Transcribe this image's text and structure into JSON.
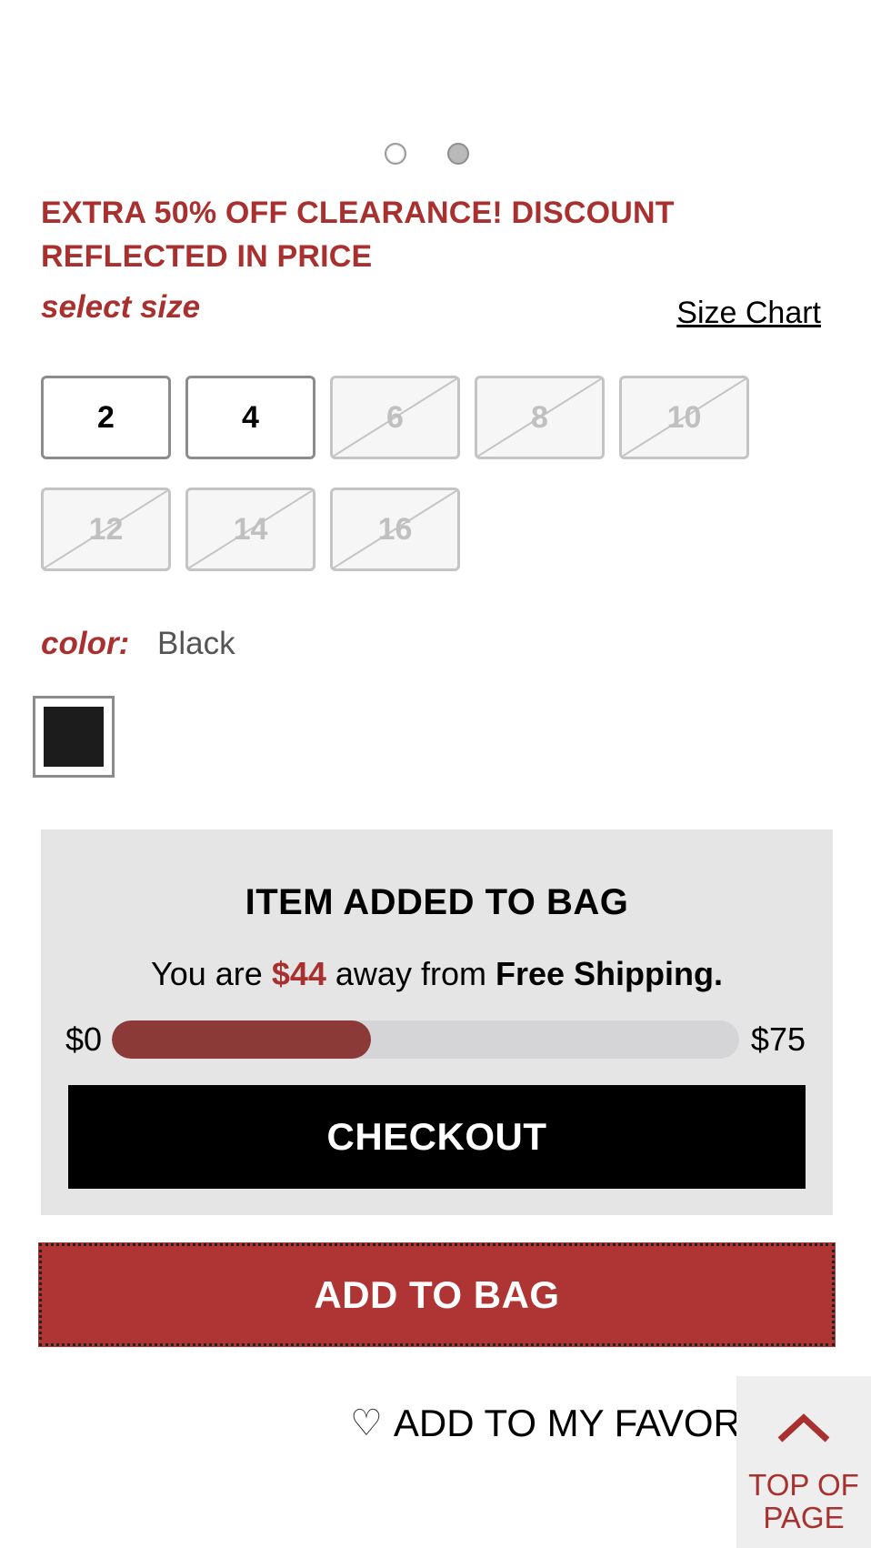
{
  "carousel": {
    "count": 2,
    "active_index": 1
  },
  "promo": {
    "text": "EXTRA 50% OFF CLEARANCE! DISCOUNT REFLECTED IN PRICE"
  },
  "size": {
    "label": "select size",
    "chart_link": "Size Chart",
    "options": [
      {
        "value": "2",
        "available": true
      },
      {
        "value": "4",
        "available": true
      },
      {
        "value": "6",
        "available": false
      },
      {
        "value": "8",
        "available": false
      },
      {
        "value": "10",
        "available": false
      },
      {
        "value": "12",
        "available": false
      },
      {
        "value": "14",
        "available": false
      },
      {
        "value": "16",
        "available": false
      }
    ]
  },
  "color": {
    "label": "color:",
    "value": "Black",
    "swatch_hex": "#1c1c1c"
  },
  "bag_panel": {
    "title": "ITEM ADDED TO BAG",
    "msg_prefix": "You are",
    "amount_away": "$44",
    "msg_middle": "away from",
    "msg_bold": "Free Shipping.",
    "progress_min": "$0",
    "progress_max": "$75",
    "progress_fraction": 0.413,
    "checkout_label": "CHECKOUT"
  },
  "add_to_bag": {
    "label": "ADD TO BAG"
  },
  "favorites": {
    "label": "ADD TO MY FAVORITES"
  },
  "top_of_page": {
    "label": "TOP OF PAGE"
  },
  "colors": {
    "brand_red": "#a8312f",
    "button_red": "#ae3533",
    "progress_fill": "#8b3a38"
  }
}
